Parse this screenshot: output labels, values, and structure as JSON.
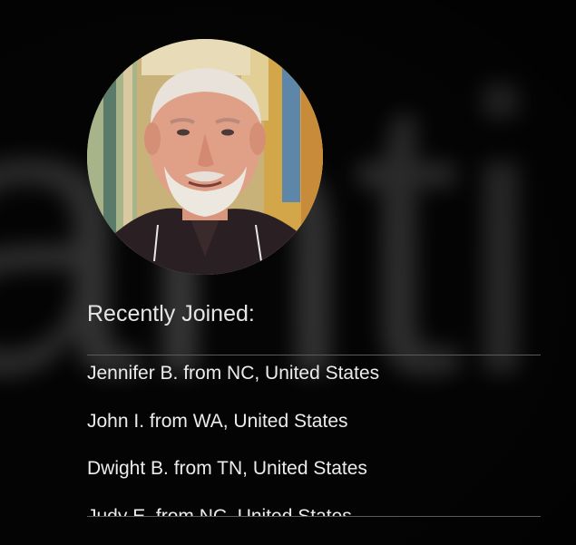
{
  "background": {
    "watermark_text": "anti"
  },
  "avatar": {
    "alt": "member portrait"
  },
  "recently_joined": {
    "title": "Recently Joined:",
    "items": [
      "Jennifer B. from NC, United States",
      "John I. from WA, United States",
      "Dwight B. from TN, United States",
      "Judy E. from NC, United States"
    ]
  },
  "colors": {
    "background": "#050505",
    "text": "#ececec",
    "divider": "#5a5a5a"
  }
}
